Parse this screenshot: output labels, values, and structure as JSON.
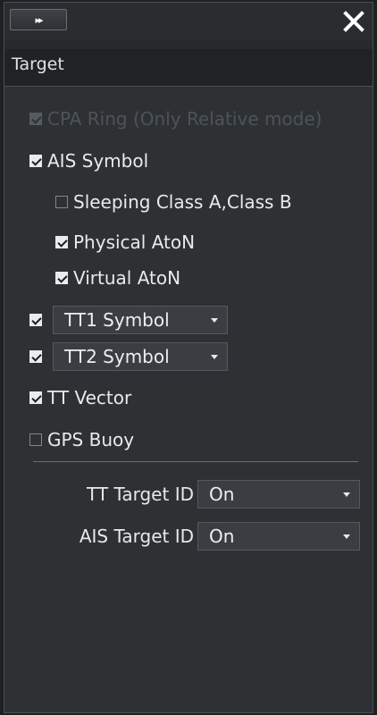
{
  "window": {
    "collapse_glyph": "▸▸",
    "close_glyph": "✕",
    "section_title": "Target"
  },
  "options": {
    "cpa_ring": {
      "label": "CPA Ring (Only Relative mode)",
      "checked": true,
      "enabled": false
    },
    "ais_symbol": {
      "label": "AIS Symbol",
      "checked": true
    },
    "sleeping": {
      "label": "Sleeping Class A,Class B",
      "checked": false
    },
    "physical_aton": {
      "label": "Physical AtoN",
      "checked": true
    },
    "virtual_aton": {
      "label": "Virtual AtoN",
      "checked": true
    },
    "tt1_symbol": {
      "label": "TT1 Symbol",
      "checked": true
    },
    "tt2_symbol": {
      "label": "TT2 Symbol",
      "checked": true
    },
    "tt_vector": {
      "label": "TT Vector",
      "checked": true
    },
    "gps_buoy": {
      "label": "GPS Buoy",
      "checked": false
    }
  },
  "ids": {
    "tt_target_label": "TT Target ID",
    "tt_target_value": "On",
    "ais_target_label": "AIS Target ID",
    "ais_target_value": "On"
  }
}
